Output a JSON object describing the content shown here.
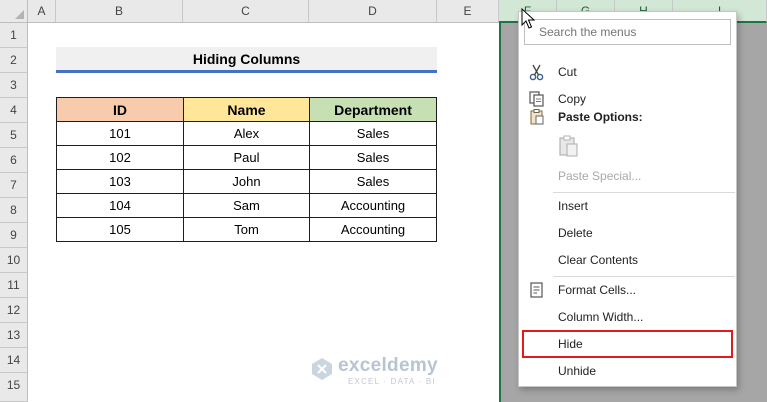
{
  "sheet": {
    "columns": [
      "A",
      "B",
      "C",
      "D",
      "E",
      "F",
      "G",
      "H",
      "I"
    ],
    "rows": [
      "1",
      "2",
      "3",
      "4",
      "5",
      "6",
      "7",
      "8",
      "9",
      "10",
      "11",
      "12",
      "13",
      "14",
      "15"
    ],
    "selected_column": "F"
  },
  "title": "Hiding Columns",
  "table": {
    "headers": [
      "ID",
      "Name",
      "Department"
    ],
    "header_colors": [
      "#f8cbad",
      "#ffe699",
      "#c6e0b4"
    ],
    "rows": [
      [
        "101",
        "Alex",
        "Sales"
      ],
      [
        "102",
        "Paul",
        "Sales"
      ],
      [
        "103",
        "John",
        "Sales"
      ],
      [
        "104",
        "Sam",
        "Accounting"
      ],
      [
        "105",
        "Tom",
        "Accounting"
      ]
    ]
  },
  "context_menu": {
    "search_placeholder": "Search the menus",
    "items": [
      {
        "label": "Cut",
        "icon": "scissors-icon"
      },
      {
        "label": "Copy",
        "icon": "copy-icon"
      },
      {
        "label": "Paste Options:",
        "icon": "clipboard-icon"
      },
      {
        "label": "Paste Special...",
        "icon": "clipboard-icon"
      },
      {
        "label": "Insert"
      },
      {
        "label": "Delete"
      },
      {
        "label": "Clear Contents"
      },
      {
        "label": "Format Cells...",
        "icon": "format-cells-icon"
      },
      {
        "label": "Column Width..."
      },
      {
        "label": "Hide"
      },
      {
        "label": "Unhide"
      }
    ]
  },
  "watermark": {
    "name": "exceldemy",
    "tagline": "EXCEL · DATA · BI"
  },
  "colors": {
    "accent": "#217346",
    "highlight_box": "#e31a1a",
    "title_underline": "#4472c4"
  }
}
